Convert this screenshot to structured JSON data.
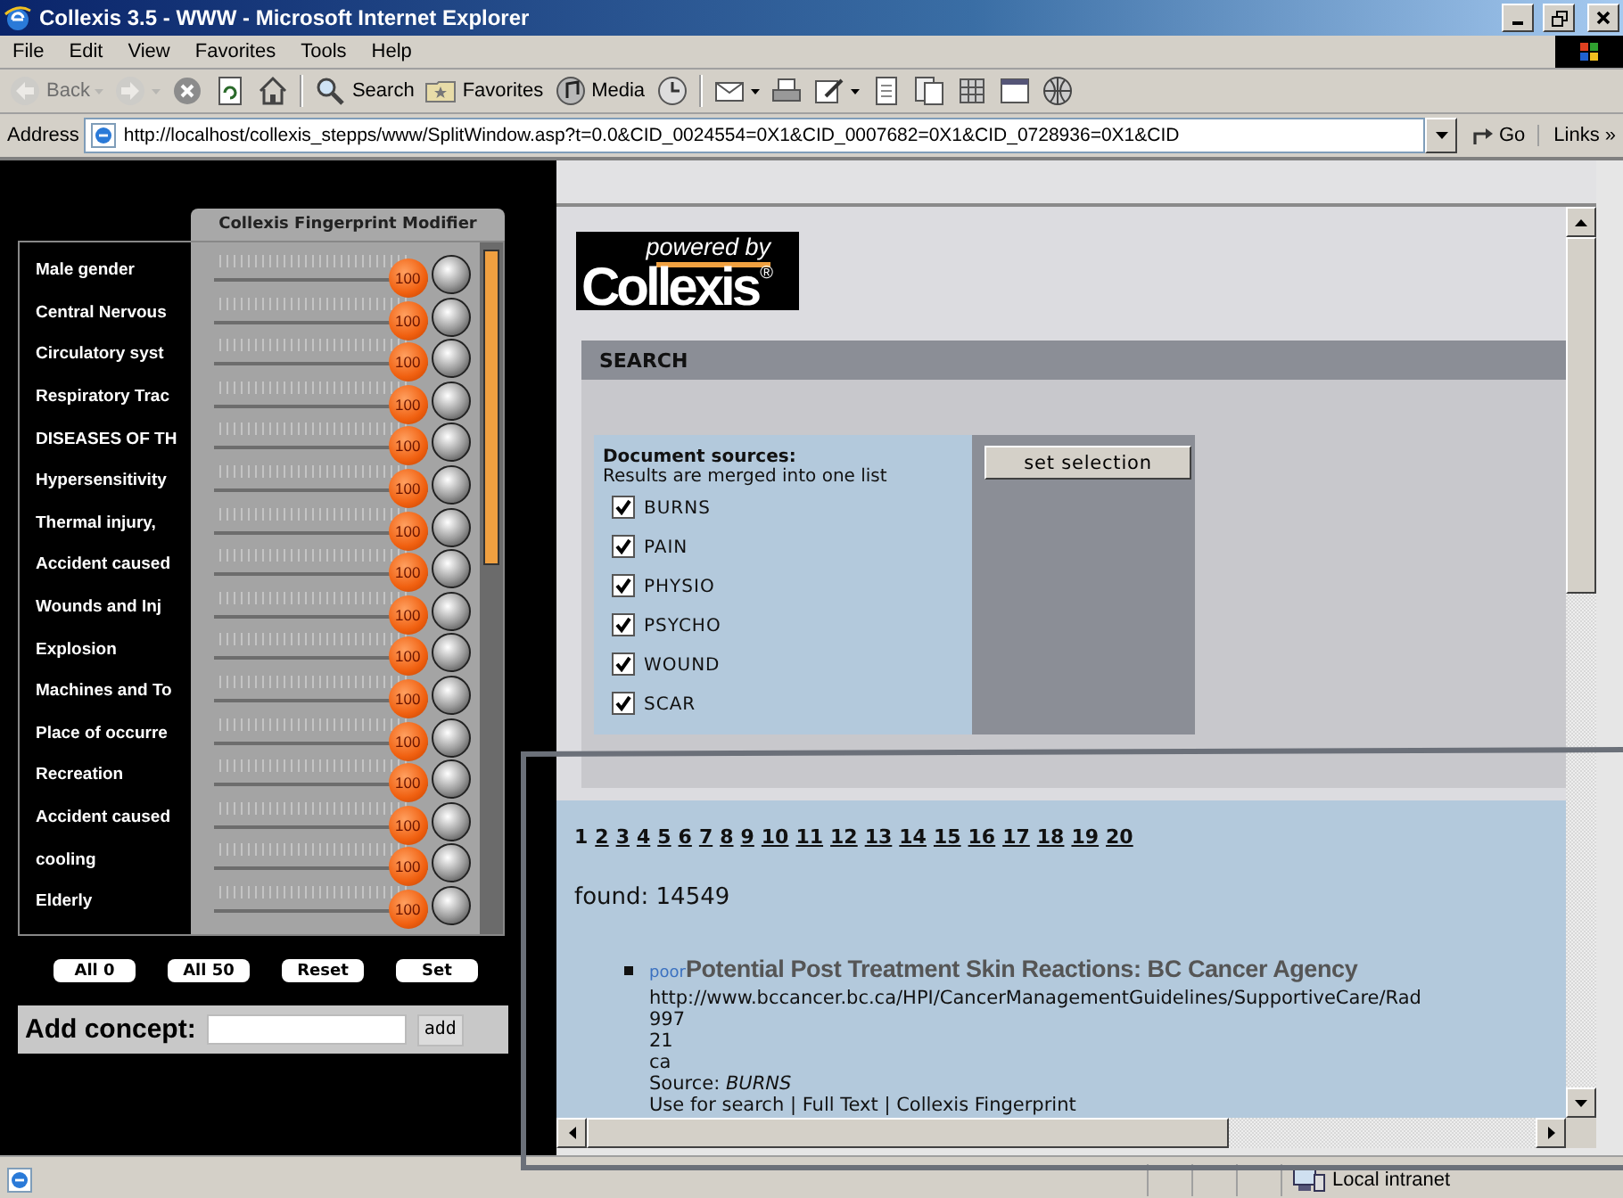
{
  "window": {
    "title": "Collexis 3.5 - WWW - Microsoft Internet Explorer"
  },
  "menu": [
    {
      "label": "File"
    },
    {
      "label": "Edit"
    },
    {
      "label": "View"
    },
    {
      "label": "Favorites"
    },
    {
      "label": "Tools"
    },
    {
      "label": "Help"
    }
  ],
  "toolbar": [
    [
      {
        "kind": "back",
        "label": "Back",
        "disabled": true,
        "menu": true
      },
      {
        "kind": "forward",
        "disabled": true,
        "menu": true
      },
      {
        "kind": "stop",
        "disabled": false,
        "menu": false
      },
      {
        "kind": "refresh",
        "disabled": false,
        "menu": false
      },
      {
        "kind": "home",
        "disabled": false,
        "menu": false
      }
    ],
    [
      {
        "kind": "search",
        "label": "Search",
        "disabled": false,
        "menu": false
      },
      {
        "kind": "favorites",
        "label": "Favorites",
        "disabled": false,
        "menu": false
      },
      {
        "kind": "media",
        "label": "Media",
        "disabled": false,
        "menu": false
      },
      {
        "kind": "history",
        "disabled": false,
        "menu": false
      }
    ],
    [
      {
        "kind": "mail",
        "disabled": false,
        "menu": true
      },
      {
        "kind": "print",
        "disabled": false,
        "menu": false
      },
      {
        "kind": "edit",
        "disabled": false,
        "menu": true
      },
      {
        "kind": "page",
        "disabled": false,
        "menu": false
      },
      {
        "kind": "pages",
        "disabled": false,
        "menu": false
      },
      {
        "kind": "grid",
        "disabled": false,
        "menu": false
      },
      {
        "kind": "window",
        "disabled": false,
        "menu": false
      },
      {
        "kind": "globe",
        "disabled": false,
        "menu": false
      }
    ]
  ],
  "address": {
    "label": "Address",
    "url": "http://localhost/collexis_stepps/www/SplitWindow.asp?t=0.0&CID_0024554=0X1&CID_0007682=0X1&CID_0728936=0X1&CID",
    "go": "Go",
    "links": "Links »"
  },
  "modifier": {
    "title": "Collexis Fingerprint Modifier",
    "concepts": [
      {
        "label": "Male gender",
        "value": "100",
        "level": 1
      },
      {
        "label": "Central Nervous",
        "value": "100",
        "level": 1
      },
      {
        "label": "Circulatory syst",
        "value": "100",
        "level": 1
      },
      {
        "label": "Respiratory Trac",
        "value": "100",
        "level": 1
      },
      {
        "label": "DISEASES OF TH",
        "value": "100",
        "level": 1
      },
      {
        "label": "Hypersensitivity",
        "value": "100",
        "level": 1
      },
      {
        "label": "Thermal injury,",
        "value": "100",
        "level": 1
      },
      {
        "label": "Accident caused",
        "value": "100",
        "level": 1
      },
      {
        "label": "Wounds and Inj",
        "value": "100",
        "level": 1
      },
      {
        "label": "Explosion",
        "value": "100",
        "level": 1
      },
      {
        "label": "Machines and To",
        "value": "100",
        "level": 1
      },
      {
        "label": "Place of occurre",
        "value": "100",
        "level": 1
      },
      {
        "label": "Recreation",
        "value": "100",
        "level": 1
      },
      {
        "label": "Accident caused",
        "value": "100",
        "level": 1
      },
      {
        "label": "cooling",
        "value": "100",
        "level": 1
      },
      {
        "label": "Elderly",
        "value": "100",
        "level": 1
      }
    ],
    "buttons": [
      "All 0",
      "All 50",
      "Reset",
      "Set"
    ],
    "add_concept": {
      "label": "Add concept:",
      "button": "add"
    }
  },
  "search": {
    "logo": {
      "tagline": "powered by",
      "name": "Collexis",
      "mark": "®"
    },
    "heading": "SEARCH",
    "sources": {
      "title": "Document sources:",
      "note": "Results are merged into one list",
      "items": [
        {
          "label": "BURNS",
          "checked": true
        },
        {
          "label": "PAIN",
          "checked": true
        },
        {
          "label": "PHYSIO",
          "checked": true
        },
        {
          "label": "PSYCHO",
          "checked": true
        },
        {
          "label": "WOUND",
          "checked": true
        },
        {
          "label": "SCAR",
          "checked": true
        }
      ]
    },
    "set_button": "set selection"
  },
  "results": {
    "pages": [
      {
        "label": "1",
        "selected": true
      },
      {
        "label": "2",
        "selected": false
      },
      {
        "label": "3",
        "selected": false
      },
      {
        "label": "4",
        "selected": false
      },
      {
        "label": "5",
        "selected": false
      },
      {
        "label": "6",
        "selected": false
      },
      {
        "label": "7",
        "selected": false
      },
      {
        "label": "8",
        "selected": false
      },
      {
        "label": "9",
        "selected": false
      },
      {
        "label": "10",
        "selected": false
      },
      {
        "label": "11",
        "selected": false
      },
      {
        "label": "12",
        "selected": false
      },
      {
        "label": "13",
        "selected": false
      },
      {
        "label": "14",
        "selected": false
      },
      {
        "label": "15",
        "selected": false
      },
      {
        "label": "16",
        "selected": false
      },
      {
        "label": "17",
        "selected": false
      },
      {
        "label": "18",
        "selected": false
      },
      {
        "label": "19",
        "selected": false
      },
      {
        "label": "20",
        "selected": false
      }
    ],
    "found": "found: 14549",
    "items": [
      {
        "rating": "poor",
        "title": "Potential Post Treatment Skin Reactions: BC Cancer Agency",
        "url": "http://www.bccancer.bc.ca/HPI/CancerManagementGuidelines/SupportiveCare/Rad",
        "details": [
          "997",
          "21",
          "ca"
        ],
        "source": "Source: *BURNS*",
        "links": [
          "Use for search",
          "Full Text",
          "Collexis Fingerprint"
        ],
        "separator": "|"
      }
    ]
  },
  "status_bar": {
    "zone": "Local intranet"
  }
}
